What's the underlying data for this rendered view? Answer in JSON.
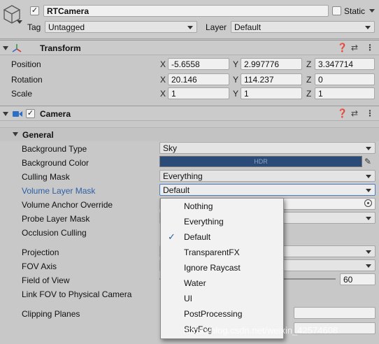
{
  "gameobject": {
    "name": "RTCamera",
    "active_checked": true,
    "static_label": "Static",
    "static_checked": false,
    "tag_label": "Tag",
    "tag_value": "Untagged",
    "layer_label": "Layer",
    "layer_value": "Default"
  },
  "transform": {
    "title": "Transform",
    "rows": [
      {
        "label": "Position",
        "x": "-5.6558",
        "y": "2.997776",
        "z": "3.347714"
      },
      {
        "label": "Rotation",
        "x": "20.146",
        "y": "114.237",
        "z": "0"
      },
      {
        "label": "Scale",
        "x": "1",
        "y": "1",
        "z": "1"
      }
    ],
    "axis_x": "X",
    "axis_y": "Y",
    "axis_z": "Z"
  },
  "camera": {
    "title": "Camera",
    "enabled": true,
    "section_general": "General",
    "background_type_label": "Background Type",
    "background_type_value": "Sky",
    "background_color_label": "Background Color",
    "background_color_hdr": "HDR",
    "background_color_hex": "#2a4a78",
    "culling_mask_label": "Culling Mask",
    "culling_mask_value": "Everything",
    "volume_layer_mask_label": "Volume Layer Mask",
    "volume_layer_mask_value": "Default",
    "volume_anchor_label": "Volume Anchor Override",
    "probe_layer_label": "Probe Layer Mask",
    "occlusion_label": "Occlusion Culling",
    "projection_label": "Projection",
    "fov_axis_label": "FOV Axis",
    "fov_label": "Field of View",
    "fov_value": "60",
    "link_fov_label": "Link FOV to Physical Camera",
    "clipping_label": "Clipping Planes"
  },
  "layer_menu": {
    "items": [
      {
        "label": "Nothing",
        "checked": false
      },
      {
        "label": "Everything",
        "checked": false
      },
      {
        "label": "Default",
        "checked": true
      },
      {
        "label": "TransparentFX",
        "checked": false
      },
      {
        "label": "Ignore Raycast",
        "checked": false
      },
      {
        "label": "Water",
        "checked": false
      },
      {
        "label": "UI",
        "checked": false
      },
      {
        "label": "PostProcessing",
        "checked": false
      },
      {
        "label": "SkyFog",
        "checked": false
      }
    ]
  },
  "watermark": "https://blog.csdn.net/weixin_42574608",
  "colors": {
    "accent_label": "#2b5fa8",
    "hdr_swatch": "#2a4a78"
  }
}
